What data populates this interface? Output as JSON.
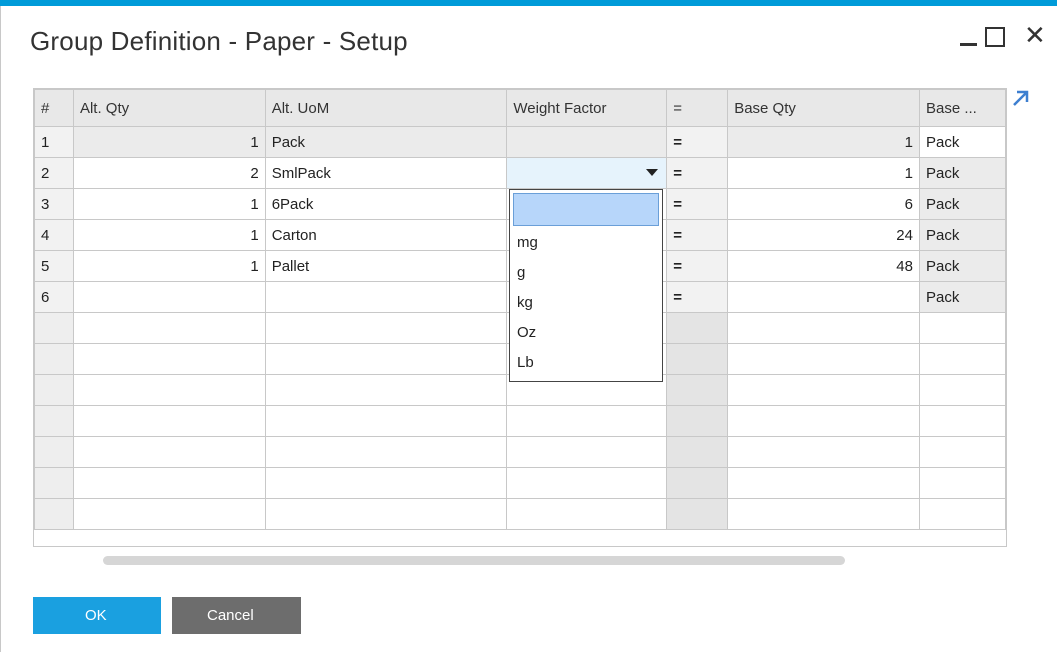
{
  "window": {
    "title": "Group Definition - Paper - Setup",
    "accent_color": "#009bd9"
  },
  "grid": {
    "columns": [
      "#",
      "Alt. Qty",
      "Alt. UoM",
      "Weight Factor",
      "=",
      "Base Qty",
      "Base ..."
    ],
    "rows": [
      {
        "num": "1",
        "alt_qty": "1",
        "alt_uom": "Pack",
        "weight_factor": "",
        "eq": "=",
        "base_qty": "1",
        "base_uom": "Pack"
      },
      {
        "num": "2",
        "alt_qty": "2",
        "alt_uom": "SmlPack",
        "weight_factor": "",
        "eq": "=",
        "base_qty": "1",
        "base_uom": "Pack"
      },
      {
        "num": "3",
        "alt_qty": "1",
        "alt_uom": "6Pack",
        "weight_factor": "",
        "eq": "=",
        "base_qty": "6",
        "base_uom": "Pack"
      },
      {
        "num": "4",
        "alt_qty": "1",
        "alt_uom": "Carton",
        "weight_factor": "",
        "eq": "=",
        "base_qty": "24",
        "base_uom": "Pack"
      },
      {
        "num": "5",
        "alt_qty": "1",
        "alt_uom": "Pallet",
        "weight_factor": "",
        "eq": "=",
        "base_qty": "48",
        "base_uom": "Pack"
      },
      {
        "num": "6",
        "alt_qty": "",
        "alt_uom": "",
        "weight_factor": "",
        "eq": "=",
        "base_qty": "",
        "base_uom": "Pack"
      }
    ]
  },
  "weight_dropdown": {
    "options": [
      "",
      "mg",
      "g",
      "kg",
      "Oz",
      "Lb"
    ],
    "selected_index": 0
  },
  "buttons": {
    "ok": "OK",
    "cancel": "Cancel"
  }
}
